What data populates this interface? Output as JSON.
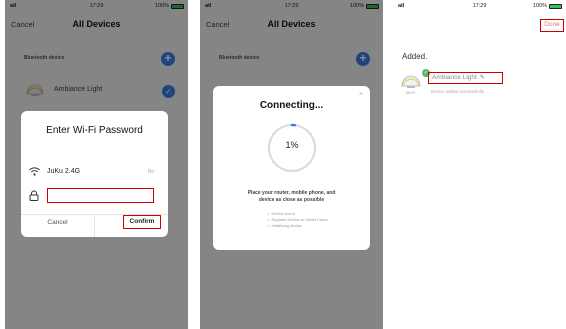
{
  "panel1": {
    "status": {
      "signal": "atl",
      "time": "17:29",
      "battery": "100%"
    },
    "nav": {
      "cancel": "Cancel",
      "title": "All Devices"
    },
    "section_label": "Bluetooth device",
    "device_name": "Ambiance Light",
    "dialog": {
      "title": "Enter Wi-Fi Password",
      "ssid": "JuKu 2.4G",
      "change": "Re",
      "password_value": "",
      "cancel": "Cancel",
      "confirm": "Confirm"
    }
  },
  "panel2": {
    "status": {
      "signal": "atl",
      "time": "17:29",
      "battery": "100%"
    },
    "nav": {
      "cancel": "Cancel",
      "title": "All Devices"
    },
    "section_label": "Bluetooth device",
    "connecting": {
      "title": "Connecting...",
      "close": "×",
      "percent": "1%",
      "progress": 0.01,
      "hint_line1": "Place your router, mobile phone, and",
      "hint_line2": "device as close as possible",
      "steps": [
        "Device found",
        "Register Device to Smart Cloud",
        "Initializing device"
      ]
    }
  },
  "panel3": {
    "status": {
      "signal": "atl",
      "time": "17:29",
      "battery": "100%"
    },
    "done": "Done",
    "added_label": "Added.",
    "device_name": "Ambiance Light",
    "device_sub": "Device added successfully",
    "wifi_tag": "Wi-Fi"
  },
  "colors": {
    "accent": "#3b7de6",
    "highlight": "#d00000",
    "success": "#5bb86a"
  }
}
